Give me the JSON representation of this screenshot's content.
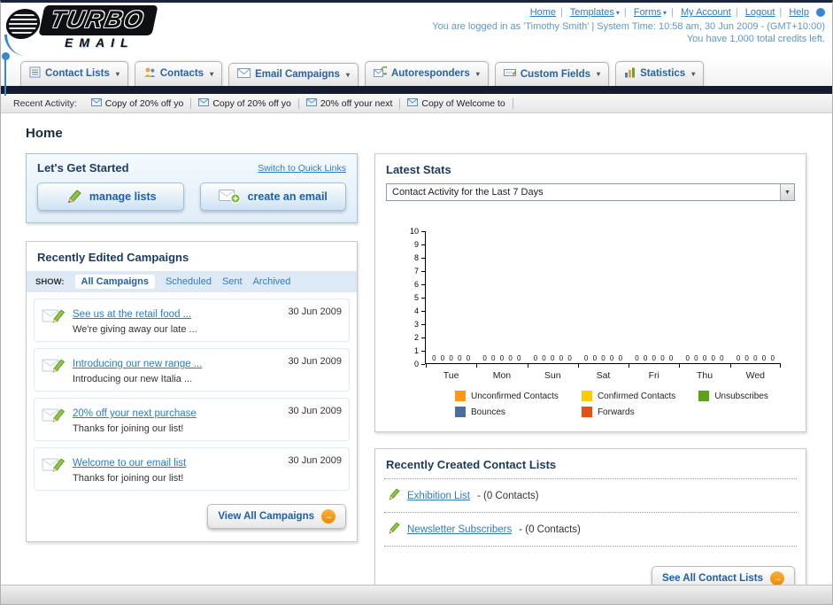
{
  "page_title": "Home",
  "header": {
    "logo": {
      "line1": "TURBO",
      "line2": "EMAIL"
    },
    "links": [
      "Home",
      "Templates",
      "Forms",
      "My Account",
      "Logout",
      "Help"
    ],
    "session_line": "You are logged in as 'Timothy Smith' | System Time: 10:58 am, 30 Jun 2009 - (GMT+10:00)",
    "credits_line": "You have 1,000 total credits left."
  },
  "main_nav": {
    "tabs": [
      {
        "label": "Contact Lists"
      },
      {
        "label": "Contacts"
      },
      {
        "label": "Email Campaigns"
      },
      {
        "label": "Autoresponders"
      },
      {
        "label": "Custom Fields"
      },
      {
        "label": "Statistics"
      }
    ]
  },
  "recent_activity": {
    "label": "Recent Activity:",
    "items": [
      "Copy of 20% off yo",
      "Copy of 20% off yo",
      "20% off your next",
      "Copy of Welcome to"
    ]
  },
  "get_started": {
    "title": "Let's Get Started",
    "switch_link": "Switch to Quick Links",
    "manage_lists_label": "manage lists",
    "create_email_label": "create an email"
  },
  "campaigns": {
    "title": "Recently Edited Campaigns",
    "show_label": "SHOW:",
    "filters": [
      "All Campaigns",
      "Scheduled",
      "Sent",
      "Archived"
    ],
    "active_filter": "All Campaigns",
    "items": [
      {
        "title": "See us at the retail food ...",
        "subtitle": "We're giving away our late ...",
        "date": "30 Jun 2009"
      },
      {
        "title": "Introducing our new range ...",
        "subtitle": "Introducing our new Italia ...",
        "date": "30 Jun 2009"
      },
      {
        "title": "20% off your next purchase",
        "subtitle": "Thanks for joining our list!",
        "date": "30 Jun 2009"
      },
      {
        "title": "Welcome to our email list",
        "subtitle": "Thanks for joining our list!",
        "date": "30 Jun 2009"
      }
    ],
    "view_all_label": "View All Campaigns"
  },
  "latest_stats": {
    "title": "Latest Stats",
    "dropdown_value": "Contact Activity for the Last 7 Days"
  },
  "chart_data": {
    "type": "bar",
    "title": "Contact Activity for the Last 7 Days",
    "categories": [
      "Tue",
      "Mon",
      "Sun",
      "Sat",
      "Fri",
      "Thu",
      "Wed"
    ],
    "series": [
      {
        "name": "Unconfirmed Contacts",
        "color": "#ff9718",
        "values": [
          0,
          0,
          0,
          0,
          0,
          0,
          0
        ]
      },
      {
        "name": "Confirmed Contacts",
        "color": "#ffcc00",
        "values": [
          0,
          0,
          0,
          0,
          0,
          0,
          0
        ]
      },
      {
        "name": "Unsubscribes",
        "color": "#5aa317",
        "values": [
          0,
          0,
          0,
          0,
          0,
          0,
          0
        ]
      },
      {
        "name": "Bounces",
        "color": "#4a6d9e",
        "values": [
          0,
          0,
          0,
          0,
          0,
          0,
          0
        ]
      },
      {
        "name": "Forwards",
        "color": "#e8500f",
        "values": [
          0,
          0,
          0,
          0,
          0,
          0,
          0
        ]
      }
    ],
    "ylim": [
      0,
      10
    ],
    "yticks": [
      0,
      1,
      2,
      3,
      4,
      5,
      6,
      7,
      8,
      9,
      10
    ],
    "value_labels": true,
    "grid": false,
    "legend_position": "bottom"
  },
  "contact_lists": {
    "title": "Recently Created Contact Lists",
    "items": [
      {
        "name": "Exhibition List",
        "detail": "- (0 Contacts)"
      },
      {
        "name": "Newsletter Subscribers",
        "detail": "- (0 Contacts)"
      }
    ],
    "see_all_label": "See All Contact Lists"
  },
  "colors": {
    "link_blue": "#2f7bbf",
    "heading_navy": "#1d3a5f",
    "dark_bar": "#141a30",
    "accent_orange": "#ec8a00"
  }
}
